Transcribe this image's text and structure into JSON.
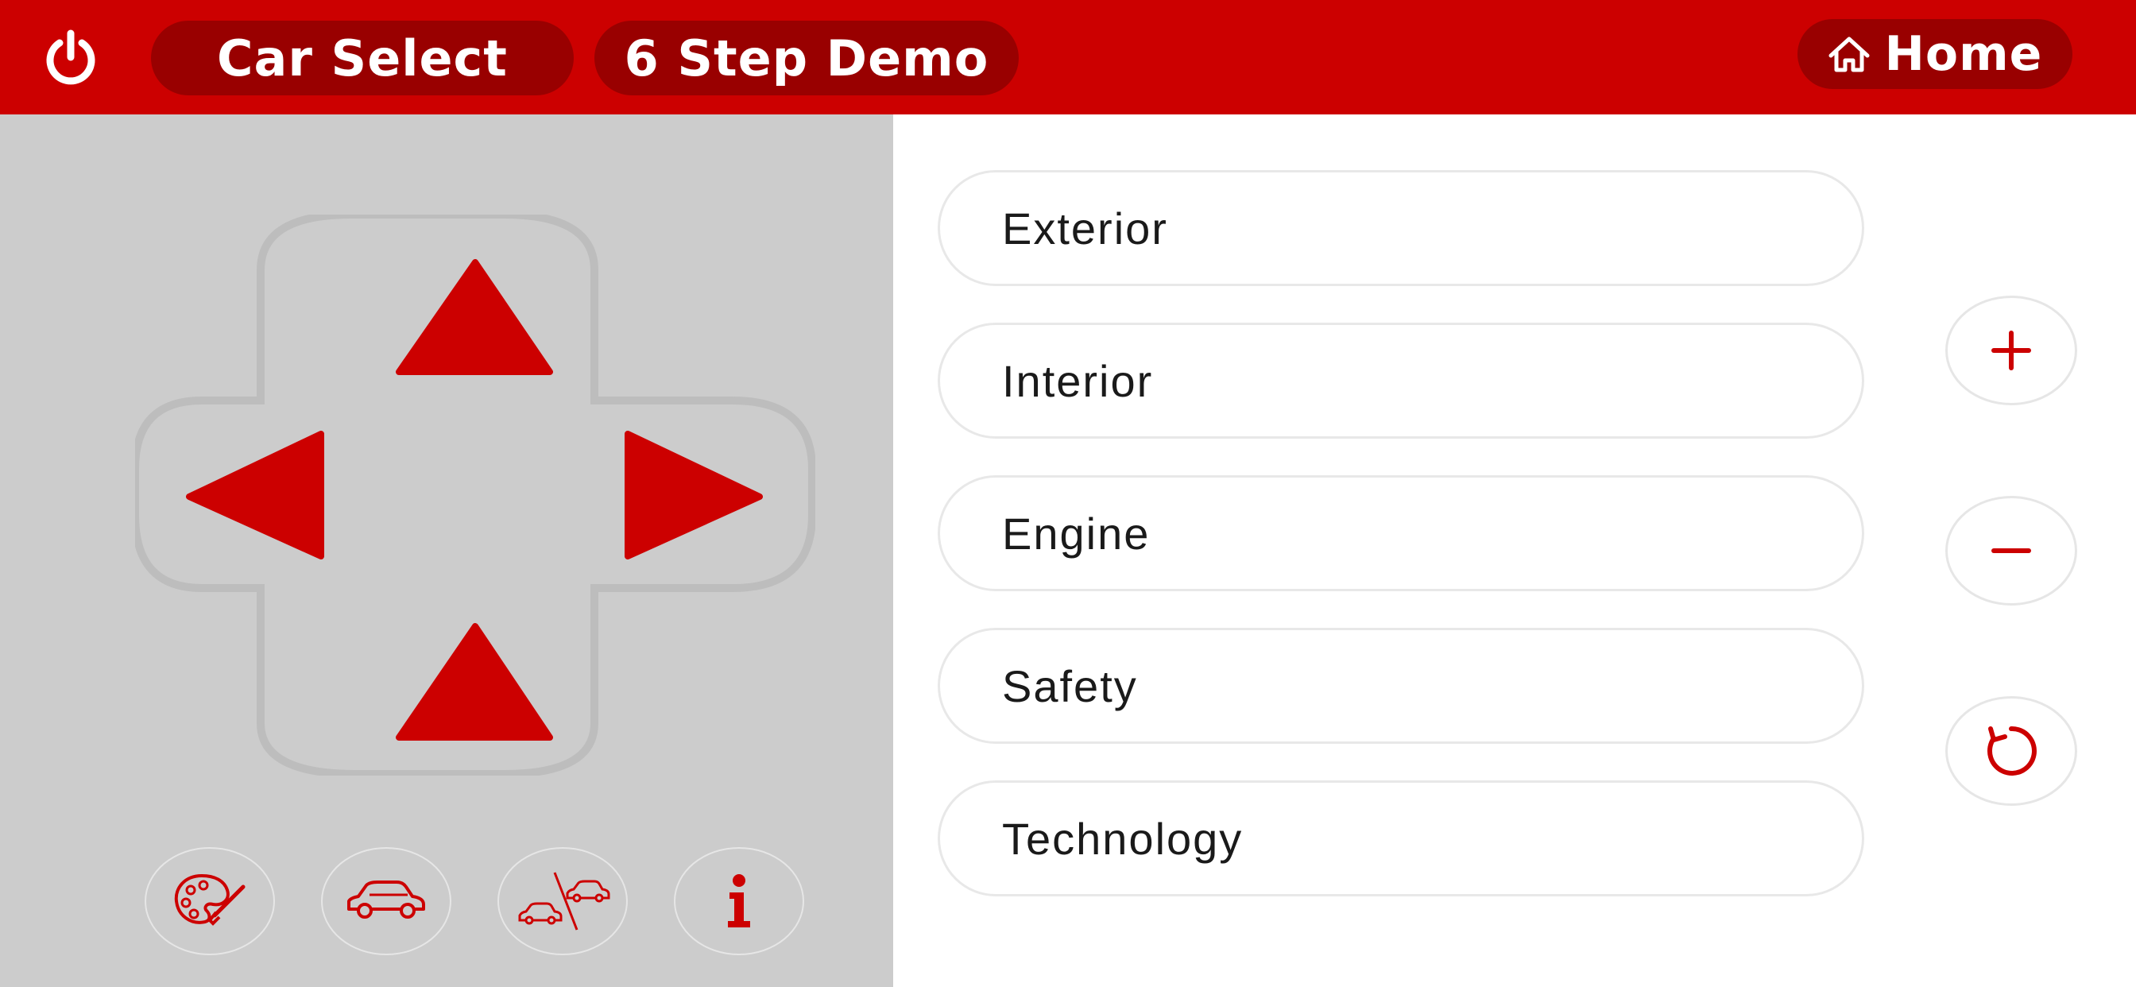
{
  "header": {
    "power_icon": "power-icon",
    "car_select_label": "Car Select",
    "demo_label": "6 Step Demo",
    "home_label": "Home",
    "home_icon": "home-icon"
  },
  "dpad": {
    "up": "arrow-up-icon",
    "down": "arrow-down-icon",
    "left": "arrow-left-icon",
    "right": "arrow-right-icon"
  },
  "tools": [
    {
      "icon": "palette-icon"
    },
    {
      "icon": "car-icon"
    },
    {
      "icon": "compare-cars-icon"
    },
    {
      "icon": "info-icon"
    }
  ],
  "menu": {
    "items": [
      {
        "label": "Exterior"
      },
      {
        "label": "Interior"
      },
      {
        "label": "Engine"
      },
      {
        "label": "Safety"
      },
      {
        "label": "Technology"
      }
    ]
  },
  "controls": [
    {
      "icon": "plus-icon"
    },
    {
      "icon": "minus-icon"
    },
    {
      "icon": "refresh-icon"
    }
  ],
  "colors": {
    "brand_red": "#cc0000",
    "pill_dark_red": "#990000",
    "panel_gray": "#cccccc",
    "dpad_outline": "#bdbdbd"
  }
}
